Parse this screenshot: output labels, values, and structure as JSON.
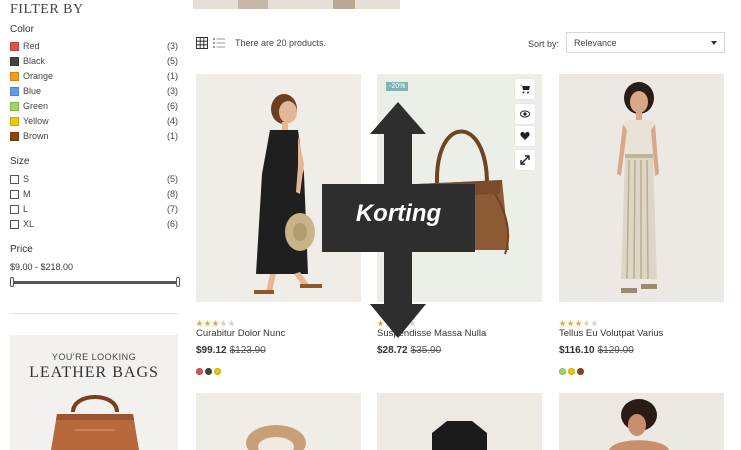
{
  "filters": {
    "title": "FILTER BY",
    "color": {
      "title": "Color",
      "items": [
        {
          "label": "Red",
          "count": "(3)",
          "swatch": "#d9534f"
        },
        {
          "label": "Black",
          "count": "(5)",
          "swatch": "#434343"
        },
        {
          "label": "Orange",
          "count": "(1)",
          "swatch": "#f39d1a"
        },
        {
          "label": "Blue",
          "count": "(3)",
          "swatch": "#5d9cec"
        },
        {
          "label": "Green",
          "count": "(6)",
          "swatch": "#a0d468"
        },
        {
          "label": "Yellow",
          "count": "(4)",
          "swatch": "#f1c40f"
        },
        {
          "label": "Brown",
          "count": "(1)",
          "swatch": "#8b4513"
        }
      ]
    },
    "size": {
      "title": "Size",
      "items": [
        {
          "label": "S",
          "count": "(5)"
        },
        {
          "label": "M",
          "count": "(8)"
        },
        {
          "label": "L",
          "count": "(7)"
        },
        {
          "label": "XL",
          "count": "(6)"
        }
      ]
    },
    "price": {
      "title": "Price",
      "range": "$9.00 - $218.00"
    }
  },
  "promo": {
    "subtitle": "YOU'RE LOOKING",
    "title": "LEATHER BAGS"
  },
  "toolbar": {
    "view_grid_icon": "grid-icon",
    "view_list_icon": "list-icon",
    "count": "There are 20 products.",
    "sort_label": "Sort by:",
    "sort_value": "Relevance"
  },
  "products": [
    {
      "name": "Curabitur Dolor Nunc",
      "price": "$99.12",
      "old_price": "$123.90",
      "rating": 3,
      "colors": [
        "#d9534f",
        "#434343",
        "#f1c40f"
      ]
    },
    {
      "name": "Suspendisse Massa Nulla",
      "price": "$28.72",
      "old_price": "$35.90",
      "rating": 3,
      "discount": "-20%",
      "colors": [],
      "actions": [
        "cart-icon",
        "eye-icon",
        "heart-icon",
        "compare-icon"
      ]
    },
    {
      "name": "Tellus Eu Volutpat Varius",
      "price": "$116.10",
      "old_price": "$129.00",
      "rating": 3,
      "colors": [
        "#a0d468",
        "#f1c40f",
        "#8b4513"
      ]
    }
  ],
  "overlay": {
    "label": "Korting"
  }
}
